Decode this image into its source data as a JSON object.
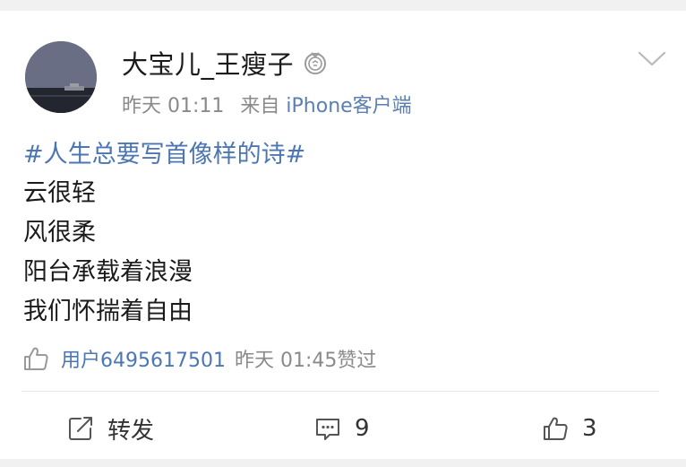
{
  "post": {
    "author": "大宝儿_王瘦子",
    "badge_icon": "medal-badge-icon",
    "time": "昨天 01:11",
    "source_prefix": "来自",
    "source_app": "iPhone客户端",
    "topic": "#人生总要写首像样的诗#",
    "lines": [
      "云很轻",
      "风很柔",
      "阳台承载着浪漫",
      "我们怀揣着自由"
    ]
  },
  "liked_by": {
    "user": "用户6495617501",
    "time": "昨天 01:45",
    "action": "赞过"
  },
  "actions": {
    "repost_label": "转发",
    "comment_count": "9",
    "like_count": "3"
  },
  "colors": {
    "link": "#4c76b3",
    "text": "#1a1a1a",
    "meta": "#8a8a8a",
    "background": "#f1f1f1"
  }
}
